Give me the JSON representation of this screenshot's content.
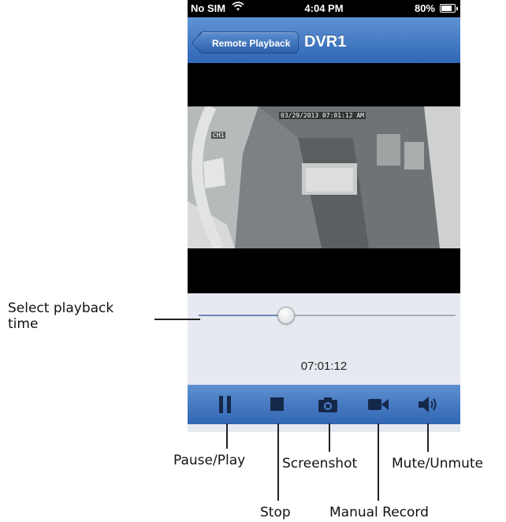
{
  "status_bar": {
    "carrier": "No SIM",
    "time": "4:04 PM",
    "battery": "80%",
    "battery_level": 0.8
  },
  "nav": {
    "back_label": "Remote Playback",
    "title": "DVR1"
  },
  "video": {
    "timestamp": "03/29/2013 07:01:12 AM",
    "channel": "CH1"
  },
  "playback": {
    "time": "07:01:12",
    "slider_fraction": 0.34
  },
  "toolbar": {
    "buttons": [
      "pause-icon",
      "stop-icon",
      "camera-icon",
      "video-camera-icon",
      "speaker-icon"
    ]
  },
  "callouts": {
    "select_time": "Select playback\ntime",
    "pause_play": "Pause/Play",
    "stop": "Stop",
    "screenshot": "Screenshot",
    "manual_record": "Manual Record",
    "mute_unmute": "Mute/Unmute"
  },
  "colors": {
    "nav_blue": "#3f74c2",
    "background": "#e6e9ef"
  }
}
